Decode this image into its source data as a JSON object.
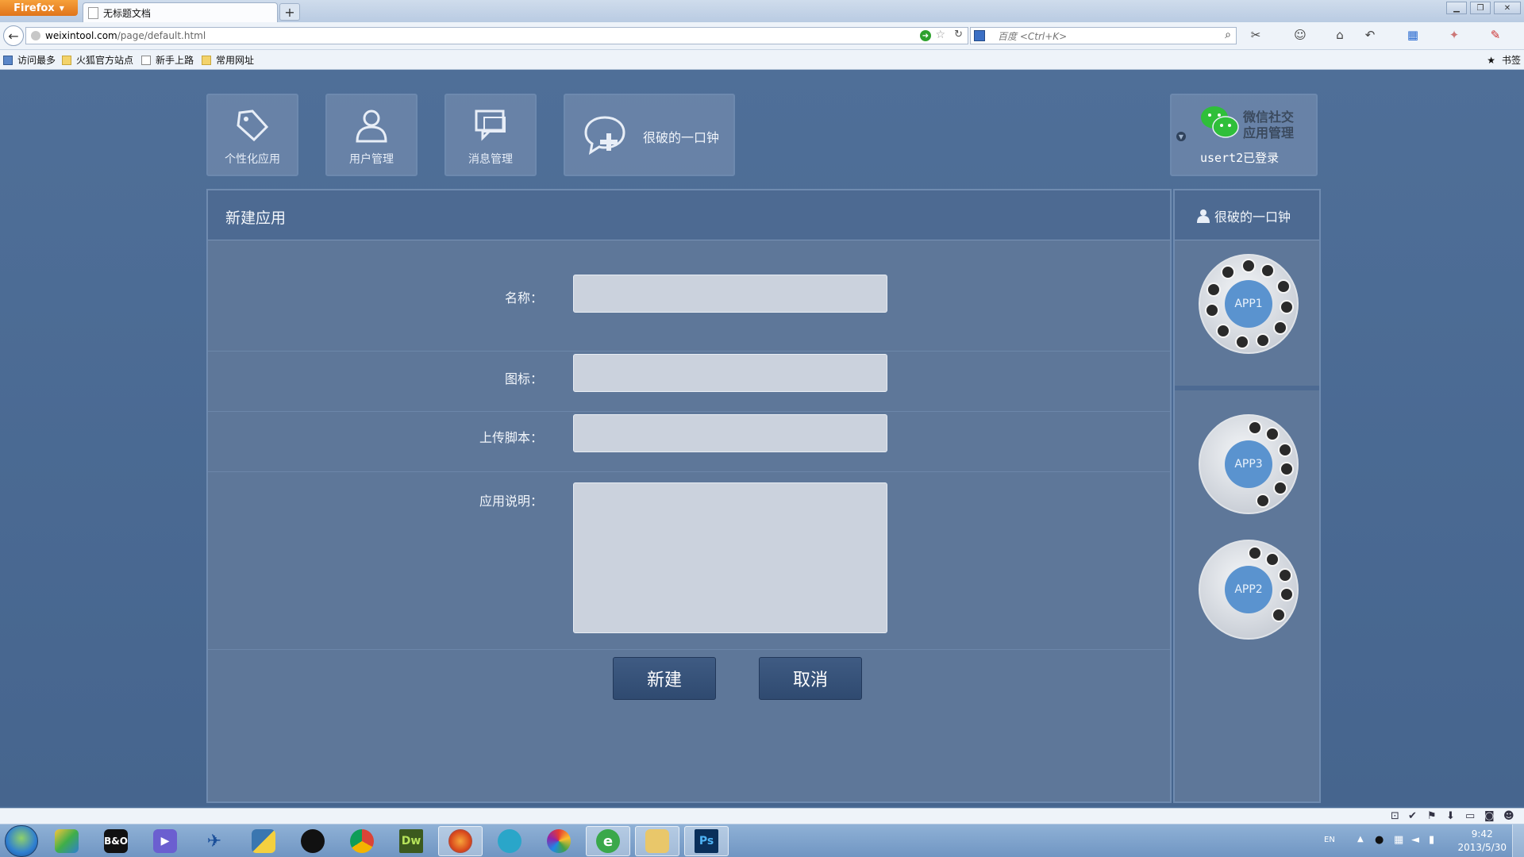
{
  "browser": {
    "firefox_button": "Firefox",
    "tab_title": "无标题文档",
    "url_host": "weixintool.com",
    "url_path": "/page/default.html",
    "search_placeholder": "百度 <Ctrl+K>",
    "bookmarks": [
      "访问最多",
      "火狐官方站点",
      "新手上路",
      "常用网址"
    ],
    "bookmarks_menu": "书签"
  },
  "nav": {
    "tiles": [
      {
        "label": "个性化应用",
        "icon": "tag-icon"
      },
      {
        "label": "用户管理",
        "icon": "user-icon"
      },
      {
        "label": "消息管理",
        "icon": "message-icon"
      }
    ],
    "current_app": "很破的一口钟"
  },
  "account": {
    "title_line1": "微信社交",
    "title_line2": "应用管理",
    "user_status": "usert2已登录"
  },
  "form": {
    "title": "新建应用",
    "name_label": "名称：",
    "icon_label": "图标：",
    "script_label": "上传脚本：",
    "desc_label": "应用说明：",
    "name_value": "",
    "icon_value": "",
    "script_value": "",
    "desc_value": "",
    "create_button": "新建",
    "cancel_button": "取消"
  },
  "sidebar": {
    "user": "很破的一口钟",
    "apps": [
      {
        "label": "APP1"
      },
      {
        "label": "APP3"
      },
      {
        "label": "APP2"
      }
    ]
  },
  "taskbar": {
    "lang": "EN",
    "time": "9:42",
    "date": "2013/5/30",
    "ps_label": "Ps",
    "dw_label": "Dw"
  },
  "colors": {
    "page_bg": "#4a6b95",
    "panel_bg": "#5e7799",
    "button_bg": "#2f4a70",
    "app_core": "#5a93cf"
  }
}
